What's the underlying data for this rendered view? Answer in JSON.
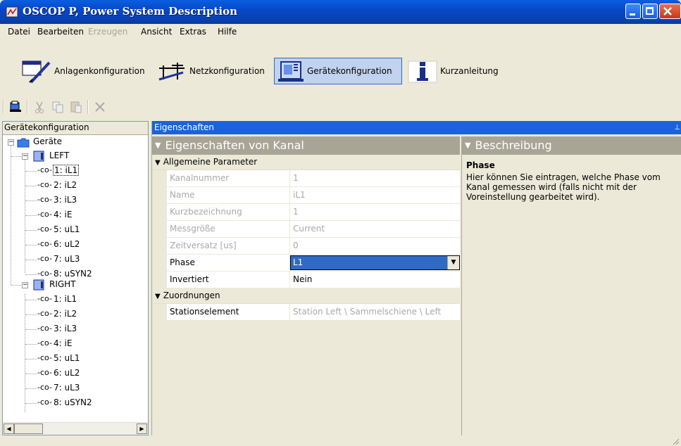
{
  "window": {
    "title": "OSCOP P, Power System Description"
  },
  "menu": [
    "Datei",
    "Bearbeiten",
    "Erzeugen",
    "Ansicht",
    "Extras",
    "Hilfe"
  ],
  "menu_disabled": [
    false,
    false,
    true,
    false,
    false,
    false
  ],
  "toolbar": [
    {
      "label": "Anlagenkonfiguration",
      "icon": "plant-config-icon"
    },
    {
      "label": "Netzkonfiguration",
      "icon": "network-config-icon"
    },
    {
      "label": "Gerätekonfiguration",
      "icon": "device-config-icon",
      "active": true
    },
    {
      "label": "Kurzanleitung",
      "icon": "info-icon"
    }
  ],
  "left_panel": {
    "header": "Gerätekonfiguration",
    "root": "Geräte",
    "devices": [
      {
        "name": "LEFT",
        "channels": [
          "1: iL1",
          "2: iL2",
          "3: iL3",
          "4: iE",
          "5: uL1",
          "6: uL2",
          "7: uL3",
          "8: uSYN2"
        ]
      },
      {
        "name": "RIGHT",
        "channels": [
          "1: iL1",
          "2: iL2",
          "3: iL3",
          "4: iE",
          "5: uL1",
          "6: uL2",
          "7: uL3",
          "8: uSYN2"
        ]
      }
    ]
  },
  "properties": {
    "header": "Eigenschaften",
    "section": "Eigenschaften von Kanal",
    "groups": [
      {
        "name": "Allgemeine Parameter",
        "rows": [
          {
            "name": "Kanalnummer",
            "value": "1",
            "disabled": true
          },
          {
            "name": "Name",
            "value": "iL1",
            "disabled": true
          },
          {
            "name": "Kurzbezeichnung",
            "value": "1",
            "disabled": true
          },
          {
            "name": "Messgröße",
            "value": "Current",
            "disabled": true
          },
          {
            "name": "Zeitversatz [us]",
            "value": "0",
            "disabled": true
          },
          {
            "name": "Phase",
            "value": "L1",
            "combo": true
          },
          {
            "name": "Invertiert",
            "value": "Nein"
          }
        ]
      },
      {
        "name": "Zuordnungen",
        "rows": [
          {
            "name": "Stationselement",
            "value": "Station Left \\ Sammelschiene \\ Left",
            "disabled": true
          }
        ]
      }
    ]
  },
  "description": {
    "section": "Beschreibung",
    "title": "Phase",
    "text": "Hier können Sie eintragen, welche Phase vom Kanal gemessen wird (falls nicht mit der Voreinstellung gearbeitet wird)."
  }
}
